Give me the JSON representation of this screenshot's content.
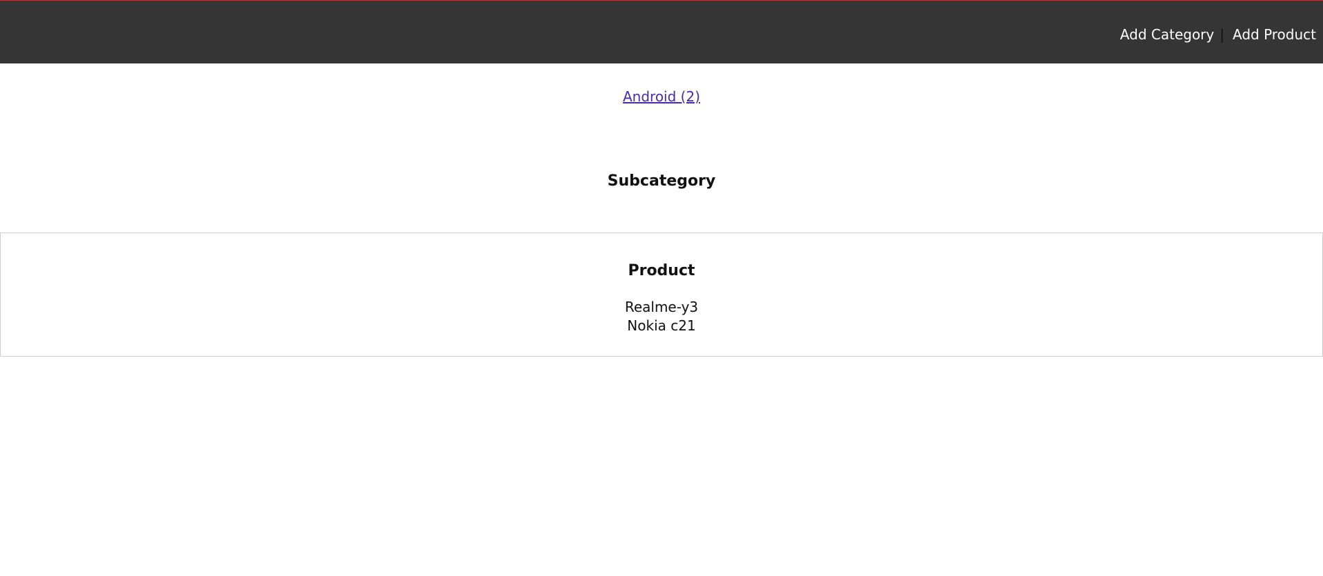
{
  "header": {
    "nav": [
      {
        "label": "Add Category"
      },
      {
        "label": "Add Product"
      }
    ],
    "separator": "|"
  },
  "categories": [
    {
      "label": "Android (2)"
    }
  ],
  "subcategory": {
    "heading": "Subcategory"
  },
  "product_section": {
    "heading": "Product",
    "items": [
      "Realme-y3",
      "Nokia c21"
    ]
  },
  "colors": {
    "header_bg": "#353535",
    "header_accent": "#b03a3a",
    "link": "#4b2aa8",
    "panel_border": "#cfcfcf"
  }
}
